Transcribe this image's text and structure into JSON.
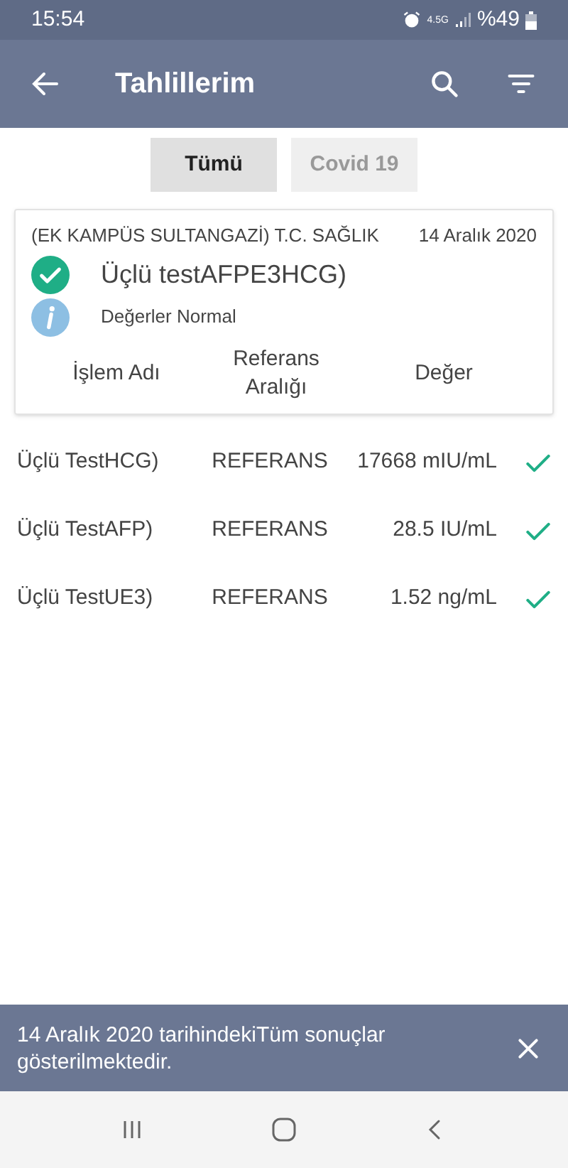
{
  "status_bar": {
    "time": "15:54",
    "network": "4.5G",
    "battery": "%49"
  },
  "header": {
    "title": "Tahlillerim"
  },
  "tabs": [
    {
      "label": "Tümü",
      "selected": true
    },
    {
      "label": "Covid 19",
      "selected": false
    }
  ],
  "card": {
    "institution": "(EK KAMPÜS SULTANGAZİ) T.C. SAĞLIK",
    "date": "14 Aralık 2020",
    "test_name": "Üçlü testAFPE3HCG)",
    "ok": true,
    "note": "Değerler Normal",
    "columns": [
      "İşlem Adı",
      "Referans Aralığı",
      "Değer"
    ]
  },
  "rows": [
    {
      "name": "Üçlü TestHCG)",
      "reference": "REFERANS",
      "value": "17668 mIU/mL",
      "ok": true
    },
    {
      "name": "Üçlü TestAFP)",
      "reference": "REFERANS",
      "value": "28.5 IU/mL",
      "ok": true
    },
    {
      "name": "Üçlü TestUE3)",
      "reference": "REFERANS",
      "value": "1.52 ng/mL",
      "ok": true
    }
  ],
  "snackbar": {
    "message": "14 Aralık 2020 tarihindekiTüm sonuçlar gösterilmektedir."
  }
}
